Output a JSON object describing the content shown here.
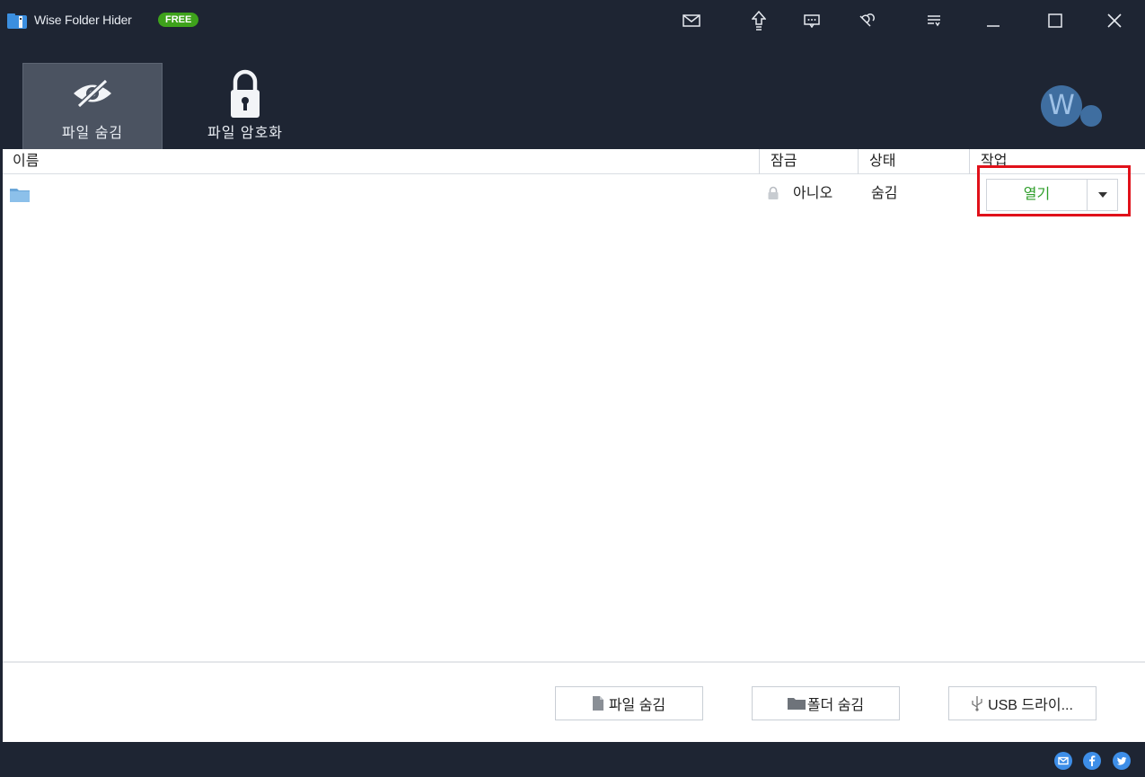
{
  "app": {
    "title": "Wise Folder Hider",
    "badge": "FREE",
    "avatar_letter": "W"
  },
  "titlebar_icons": [
    "mail-icon",
    "upgrade-icon",
    "feedback-icon",
    "settings-icon",
    "menu-icon",
    "minimize-icon",
    "maximize-icon",
    "close-icon"
  ],
  "tabs": [
    {
      "label": "파일 숨김",
      "icon": "hidden-eye-icon",
      "active": true
    },
    {
      "label": "파일 암호화",
      "icon": "lock-icon",
      "active": false
    }
  ],
  "table": {
    "columns": {
      "name": "이름",
      "lock": "잠금",
      "status": "상태",
      "action": "작업"
    },
    "rows": [
      {
        "name": "",
        "lock": "아니오",
        "status": "숨김",
        "action": "열기"
      }
    ]
  },
  "actions": {
    "hide_file": "파일 숨김",
    "hide_folder": "폴더 숨김",
    "usb_drive": "USB 드라이..."
  },
  "colors": {
    "header_bg": "#1e2533",
    "accent_green": "#3ea21b",
    "open_text": "#2e9e29",
    "highlight": "#e0111a",
    "social_blue": "#3d8ee8"
  }
}
